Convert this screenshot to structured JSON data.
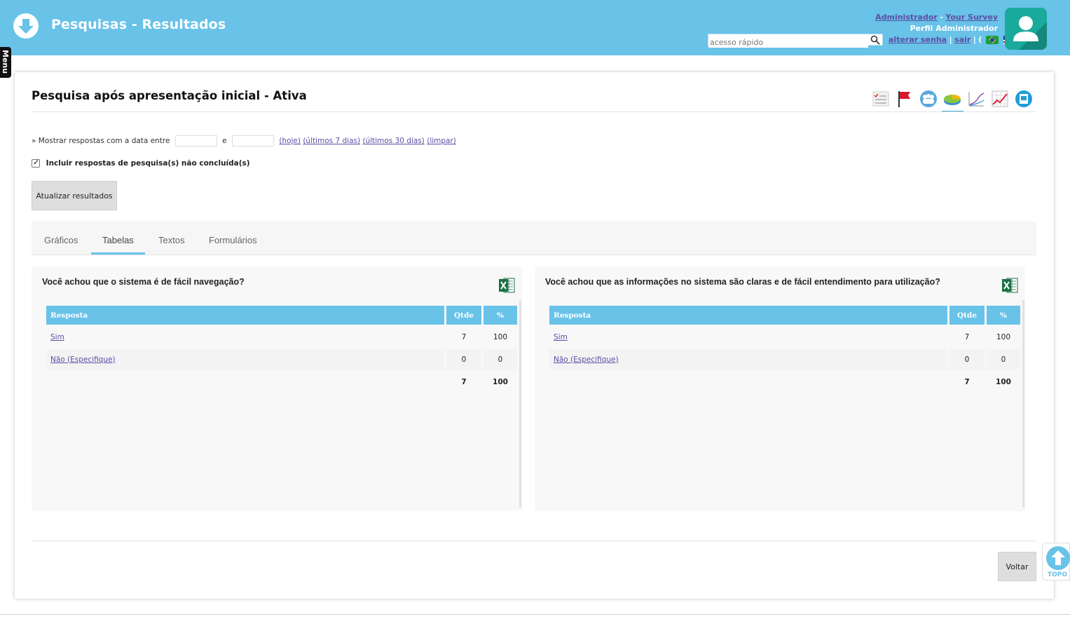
{
  "header": {
    "title": "Pesquisas - Resultados",
    "user_link": "Administrador",
    "dash": "-",
    "survey_link": "Your Survey",
    "profile": "Perfil Administrador",
    "search_placeholder": "acesso rápido",
    "change_password": "alterar senha",
    "pipe": "|",
    "logout": "sair",
    "paren_open": "(",
    "paren_close": ")"
  },
  "menu": {
    "label": "Menu"
  },
  "survey": {
    "title": "Pesquisa após apresentação inicial - Ativa"
  },
  "toolbar": [
    "checklist-icon",
    "flag-icon",
    "users-icon",
    "pie-chart-icon",
    "line-chart-icon",
    "trend-chart-icon",
    "report-icon"
  ],
  "filter": {
    "label": "» Mostrar respostas com a data entre",
    "and": "e",
    "today": "(hoje)",
    "last7": "(últimos 7 dias)",
    "last30": "(últimos 30 dias)",
    "clear": "(limpar)",
    "include_label": "Incluir respostas de pesquisa(s) não concluída(s)",
    "include_checked": true,
    "update_button": "Atualizar resultados"
  },
  "tabs": [
    {
      "label": "Gráficos"
    },
    {
      "label": "Tabelas",
      "active": true
    },
    {
      "label": "Textos"
    },
    {
      "label": "Formulários"
    }
  ],
  "columns": {
    "answer": "Resposta",
    "qty": "Qtde",
    "pct": "%"
  },
  "questions": [
    {
      "question": "Você achou que o sistema é de fácil navegação?",
      "rows": [
        {
          "answer": "Sim",
          "qty": "7",
          "pct": "100"
        },
        {
          "answer": "Não (Especifique)",
          "qty": "0",
          "pct": "0"
        }
      ],
      "total": {
        "qty": "7",
        "pct": "100"
      }
    },
    {
      "question": "Você achou que as informações no sistema são claras e de fácil entendimento para utilização?",
      "rows": [
        {
          "answer": "Sim",
          "qty": "7",
          "pct": "100"
        },
        {
          "answer": "Não (Especifique)",
          "qty": "0",
          "pct": "0"
        }
      ],
      "total": {
        "qty": "7",
        "pct": "100"
      }
    }
  ],
  "footer": {
    "back_button": "Voltar",
    "top_label": "TOPO"
  },
  "colors": {
    "header_bg": "#69c2e8",
    "link": "#5a4fa3",
    "avatar_bg": "#1aaa9b",
    "excel_green": "#1d7044"
  }
}
